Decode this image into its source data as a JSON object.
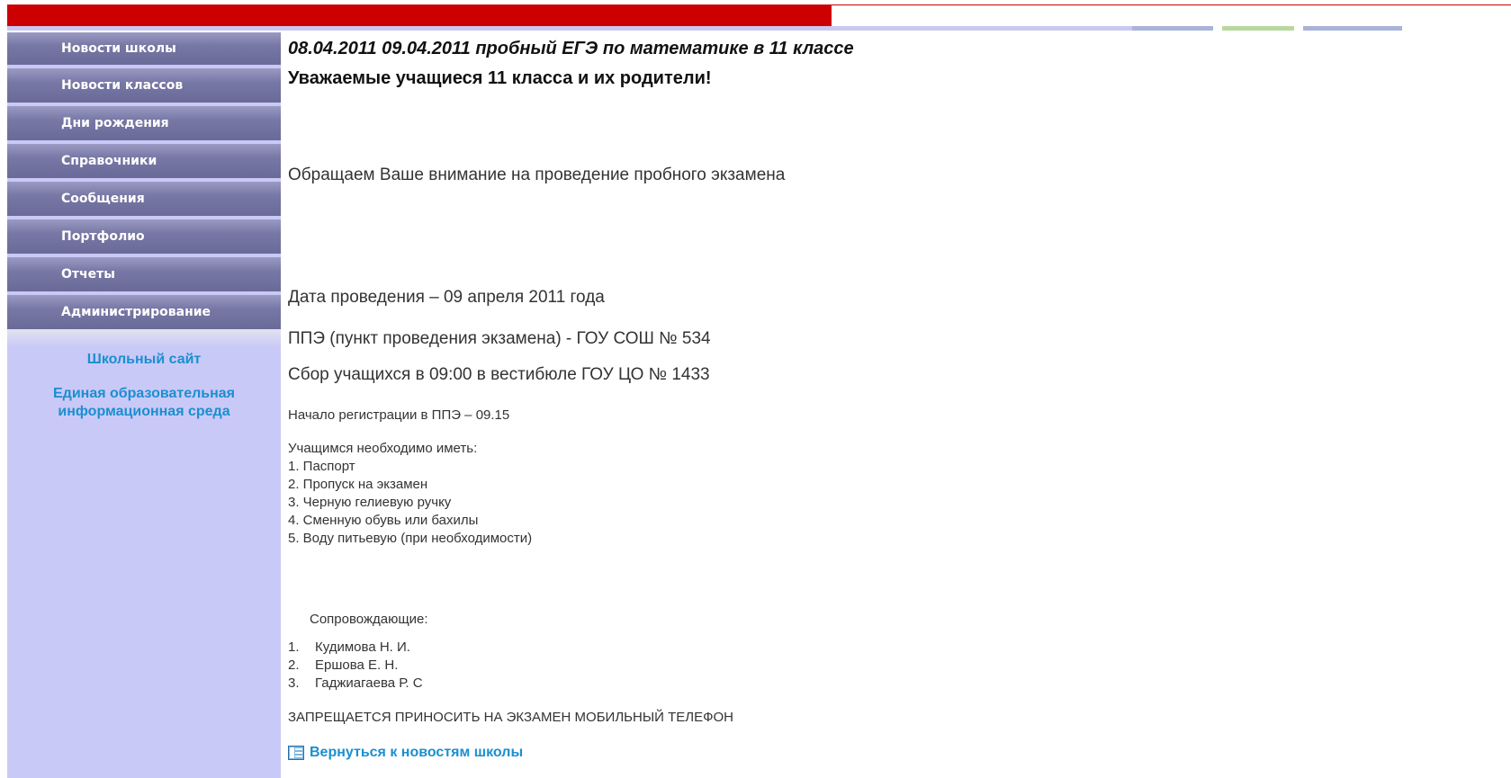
{
  "sidebar": {
    "menu": [
      {
        "label": "Новости школы"
      },
      {
        "label": "Новости классов"
      },
      {
        "label": "Дни рождения"
      },
      {
        "label": "Справочники"
      },
      {
        "label": "Сообщения"
      },
      {
        "label": "Портфолио"
      },
      {
        "label": "Отчеты"
      },
      {
        "label": "Администрирование"
      }
    ],
    "links": {
      "school_site": "Школьный сайт",
      "edu_env_line1": "Единая образовательная",
      "edu_env_line2": "информационная среда"
    }
  },
  "news": {
    "title": "08.04.2011 09.04.2011 пробный ЕГЭ по математике в 11 классе",
    "subtitle": "Уважаемые учащиеся 11 класса и их родители!",
    "notice": "Обращаем Ваше внимание на проведение пробного экзамена",
    "date": "Дата проведения – 09 апреля 2011 года",
    "place": "ППЭ (пункт проведения экзамена) - ГОУ СОШ № 534",
    "gather": "Сбор учащихся в 09:00 в вестибюле ГОУ ЦО № 1433",
    "registration": "Начало регистрации в ППЭ – 09.15",
    "need_title": "Учащимся необходимо иметь:",
    "need_items": [
      "1. Паспорт",
      "2. Пропуск на экзамен",
      "3. Черную гелиевую ручку",
      "4. Сменную обувь или бахилы",
      "5. Воду питьевую (при необходимости)"
    ],
    "escort_title": "Сопровождающие:",
    "escorts": [
      {
        "num": "1.",
        "name": "Кудимова Н. И."
      },
      {
        "num": "2.",
        "name": "Ершова Е. Н."
      },
      {
        "num": "3.",
        "name": "Гаджиагаева Р. С"
      }
    ],
    "warning": "ЗАПРЕЩАЕТСЯ ПРИНОСИТЬ НА ЭКЗАМЕН МОБИЛЬНЫЙ ТЕЛЕФОН",
    "back_link": "Вернуться к новостям школы"
  },
  "colors": {
    "header_red": "#cc0000",
    "sidebar_bg": "#c9c9f7",
    "menu_button": "#7878a6",
    "link_blue": "#1a8fd0"
  },
  "icons": {
    "back_link_icon": "news-list-icon"
  }
}
